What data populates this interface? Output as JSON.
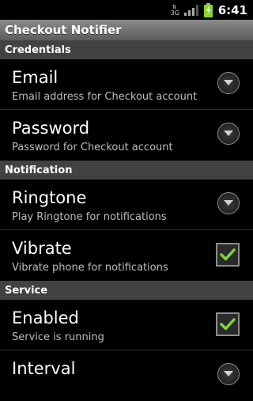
{
  "status_bar": {
    "time": "6:41",
    "network": "3G",
    "colors": {
      "battery": "#8bd42a"
    }
  },
  "app": {
    "title": "Checkout Notifier"
  },
  "sections": {
    "credentials": {
      "header": "Credentials",
      "email": {
        "title": "Email",
        "summary": "Email address for Checkout account",
        "control": "dropdown-icon"
      },
      "password": {
        "title": "Password",
        "summary": "Password for Checkout account",
        "control": "dropdown-icon"
      }
    },
    "notification": {
      "header": "Notification",
      "ringtone": {
        "title": "Ringtone",
        "summary": "Play Ringtone for notifications",
        "control": "dropdown-icon"
      },
      "vibrate": {
        "title": "Vibrate",
        "summary": "Vibrate phone for notifications",
        "checked": true
      }
    },
    "service": {
      "header": "Service",
      "enabled": {
        "title": "Enabled",
        "summary": "Service is running",
        "checked": true
      },
      "interval": {
        "title": "Interval",
        "control": "dropdown-icon"
      }
    }
  },
  "colors": {
    "check": "#7fd33a",
    "category_bg": "#424242",
    "title_bar": "#6f6f6f"
  }
}
